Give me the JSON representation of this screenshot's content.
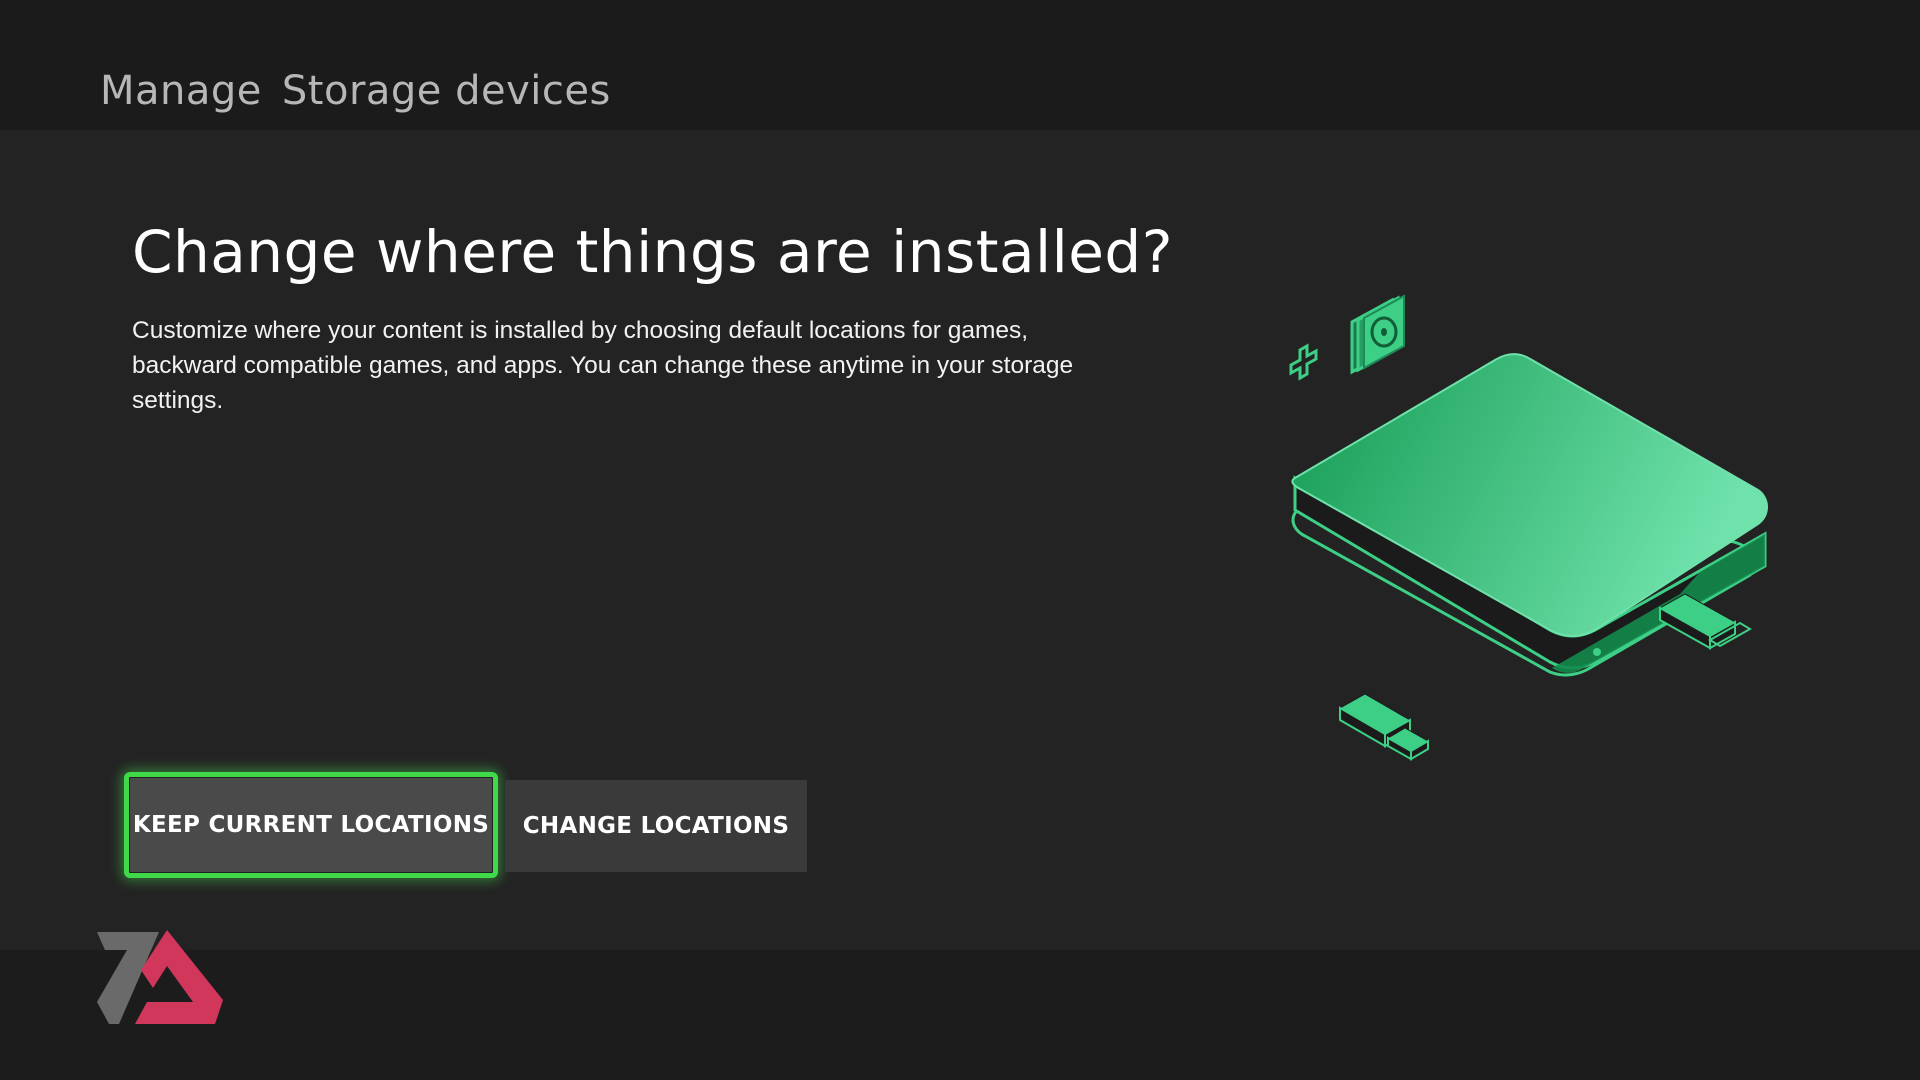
{
  "header": {
    "section": "Manage",
    "page": "Storage devices"
  },
  "dialog": {
    "title": "Change where things are installed?",
    "description": "Customize where your content is installed by choosing default locations for games, backward compatible games, and apps. You can change these anytime in your storage settings."
  },
  "actions": {
    "keep_label": "KEEP CURRENT LOCATIONS",
    "change_label": "CHANGE LOCATIONS"
  },
  "illustration": {
    "icon": "external-storage-drive-icon",
    "accent": "#3ccf85"
  },
  "colors": {
    "background": "#232323",
    "focus": "#3fd94a",
    "accent": "#3ccf85"
  }
}
